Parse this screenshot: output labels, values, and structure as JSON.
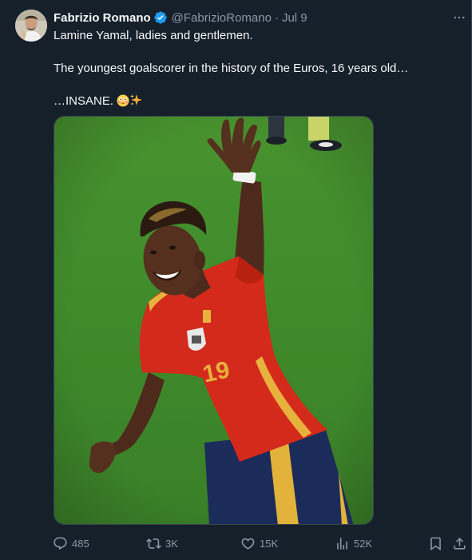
{
  "tweet": {
    "author": {
      "name": "Fabrizio Romano",
      "handle": "@FabrizioRomano",
      "verified": true
    },
    "separator": "·",
    "date": "Jul 9",
    "text": {
      "line1": "Lamine Yamal, ladies and gentlemen.",
      "line2": "The youngest goalscorer in the history of the Euros, 16 years old…",
      "line3": "…INSANE."
    },
    "emojis": [
      "😳",
      "✨"
    ],
    "media": {
      "player_shirt_number": "19"
    },
    "stats": {
      "replies": "485",
      "reposts": "3K",
      "likes": "15K",
      "views": "52K"
    }
  },
  "colors": {
    "background": "#15202b",
    "text_primary": "#f7f9f9",
    "text_secondary": "#8b98a5",
    "verified_blue": "#1d9bf0",
    "border": "#38444d"
  },
  "icons": {
    "more": "ellipsis-icon",
    "reply": "reply-icon",
    "repost": "repost-icon",
    "like": "heart-icon",
    "views": "analytics-icon",
    "bookmark": "bookmark-icon",
    "share": "share-icon"
  }
}
